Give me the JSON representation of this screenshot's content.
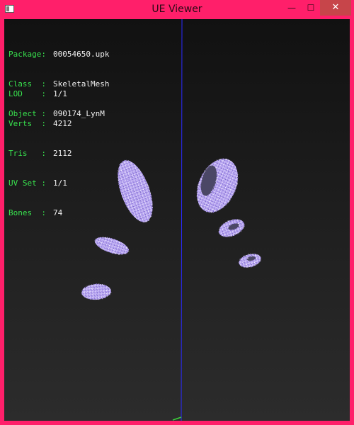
{
  "window": {
    "title": "UE Viewer",
    "controls": {
      "minimize": "—",
      "maximize": "☐",
      "close": "✕"
    },
    "colors": {
      "frame": "#ff1f6a",
      "close_button": "#c7454a",
      "label_text": "#38e24e",
      "value_text": "#f0f0f0",
      "mesh": "#b9a6f2",
      "axis_blue": "#2a2aff",
      "axis_green": "#3bd33b"
    }
  },
  "info": {
    "package_label": "Package:",
    "package_value": "00054650.upk",
    "class_label": "Class  :",
    "class_value": "SkeletalMesh",
    "object_label": "Object :",
    "object_value": "090174_LynM",
    "lod_label": "LOD    :",
    "lod_value": "1/1",
    "verts_label": "Verts  :",
    "verts_value": "4212",
    "tris_label": "Tris   :",
    "tris_value": "2112",
    "uvset_label": "UV Set :",
    "uvset_value": "1/1",
    "bones_label": "Bones  :",
    "bones_value": "74"
  }
}
